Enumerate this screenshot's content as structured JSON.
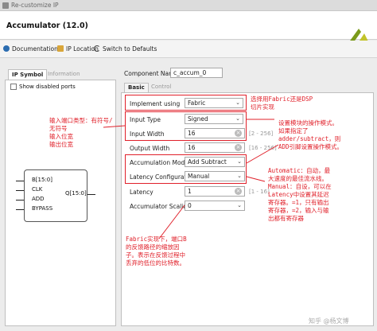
{
  "window": {
    "title": "Re-customize IP"
  },
  "header": {
    "title": "Accumulator (12.0)"
  },
  "toolbar": {
    "documentation": "Documentation",
    "ip_location": "IP Location",
    "switch_defaults": "Switch to Defaults"
  },
  "left_panel": {
    "tabs": [
      "IP Symbol",
      "Information"
    ],
    "show_disabled_label": "Show disabled ports",
    "ports": {
      "b": "B[15:0]",
      "clk": "CLK",
      "add": "ADD",
      "bypass": "BYPASS",
      "q": "Q[15:0]"
    }
  },
  "component": {
    "label": "Component Name",
    "value": "c_accum_0"
  },
  "right_tabs": [
    "Basic",
    "Control"
  ],
  "fields": {
    "implement": {
      "label": "Implement using",
      "value": "Fabric"
    },
    "input_type": {
      "label": "Input Type",
      "value": "Signed"
    },
    "input_width": {
      "label": "Input Width",
      "value": "16",
      "range": "[2 - 256]"
    },
    "output_width": {
      "label": "Output Width",
      "value": "16",
      "range": "[16 - 256]"
    },
    "accum_mode": {
      "label": "Accumulation Mode",
      "value": "Add Subtract"
    },
    "latency_config": {
      "label": "Latency Configuration",
      "value": "Manual"
    },
    "latency": {
      "label": "Latency",
      "value": "1",
      "range": "[1 - 16]"
    },
    "accum_scaling": {
      "label": "Accumulator Scaling",
      "value": "0"
    }
  },
  "annotations": {
    "a1": "选择用Fabric还是DSP\n切片实现",
    "a2": "输入端口类型：有符号/\n无符号\n输入位宽\n输出位宽",
    "a3": "设置模块的操作模式。\n如果指定了\nadder/subtract，则\nADD引脚设置操作模式。",
    "a4": "Automatic：自动，最\n大速度的最佳流水线。\nManual：自设，可以在\nLatency中设置其延迟\n寄存器。=1，只有输出\n寄存器，=2，输入与输\n出都有寄存器",
    "a5": "Fabric实现下，端口B\n的反馈路径的缩放因\n子。表示在反馈过程中\n丢弃的低位的比特数。"
  },
  "watermark": "知乎 @杨文博",
  "colors": {
    "annotation": "#e0202a",
    "accent": "#2b6cb0"
  }
}
